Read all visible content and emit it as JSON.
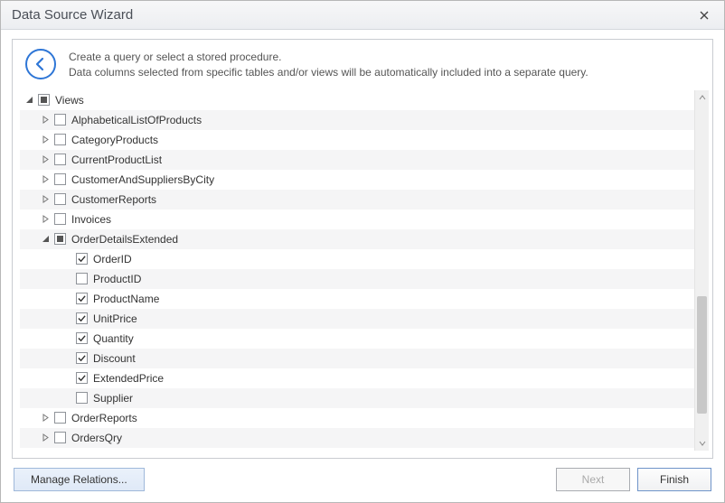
{
  "title": "Data Source Wizard",
  "header": {
    "line1": "Create a query or select a stored procedure.",
    "line2": "Data columns selected from specific tables and/or views will be automatically included into a separate query."
  },
  "tree": {
    "root_label": "Views",
    "views": [
      {
        "label": "AlphabeticalListOfProducts",
        "checked": false,
        "expanded": false
      },
      {
        "label": "CategoryProducts",
        "checked": false,
        "expanded": false
      },
      {
        "label": "CurrentProductList",
        "checked": false,
        "expanded": false
      },
      {
        "label": "CustomerAndSuppliersByCity",
        "checked": false,
        "expanded": false
      },
      {
        "label": "CustomerReports",
        "checked": false,
        "expanded": false
      },
      {
        "label": "Invoices",
        "checked": false,
        "expanded": false
      },
      {
        "label": "OrderDetailsExtended",
        "checked": "indeterminate",
        "expanded": true,
        "columns": [
          {
            "label": "OrderID",
            "checked": true
          },
          {
            "label": "ProductID",
            "checked": false
          },
          {
            "label": "ProductName",
            "checked": true
          },
          {
            "label": "UnitPrice",
            "checked": true
          },
          {
            "label": "Quantity",
            "checked": true
          },
          {
            "label": "Discount",
            "checked": true
          },
          {
            "label": "ExtendedPrice",
            "checked": true
          },
          {
            "label": "Supplier",
            "checked": false
          }
        ]
      },
      {
        "label": "OrderReports",
        "checked": false,
        "expanded": false
      },
      {
        "label": "OrdersQry",
        "checked": false,
        "expanded": false
      }
    ]
  },
  "buttons": {
    "manage": "Manage Relations...",
    "next": "Next",
    "finish": "Finish"
  }
}
